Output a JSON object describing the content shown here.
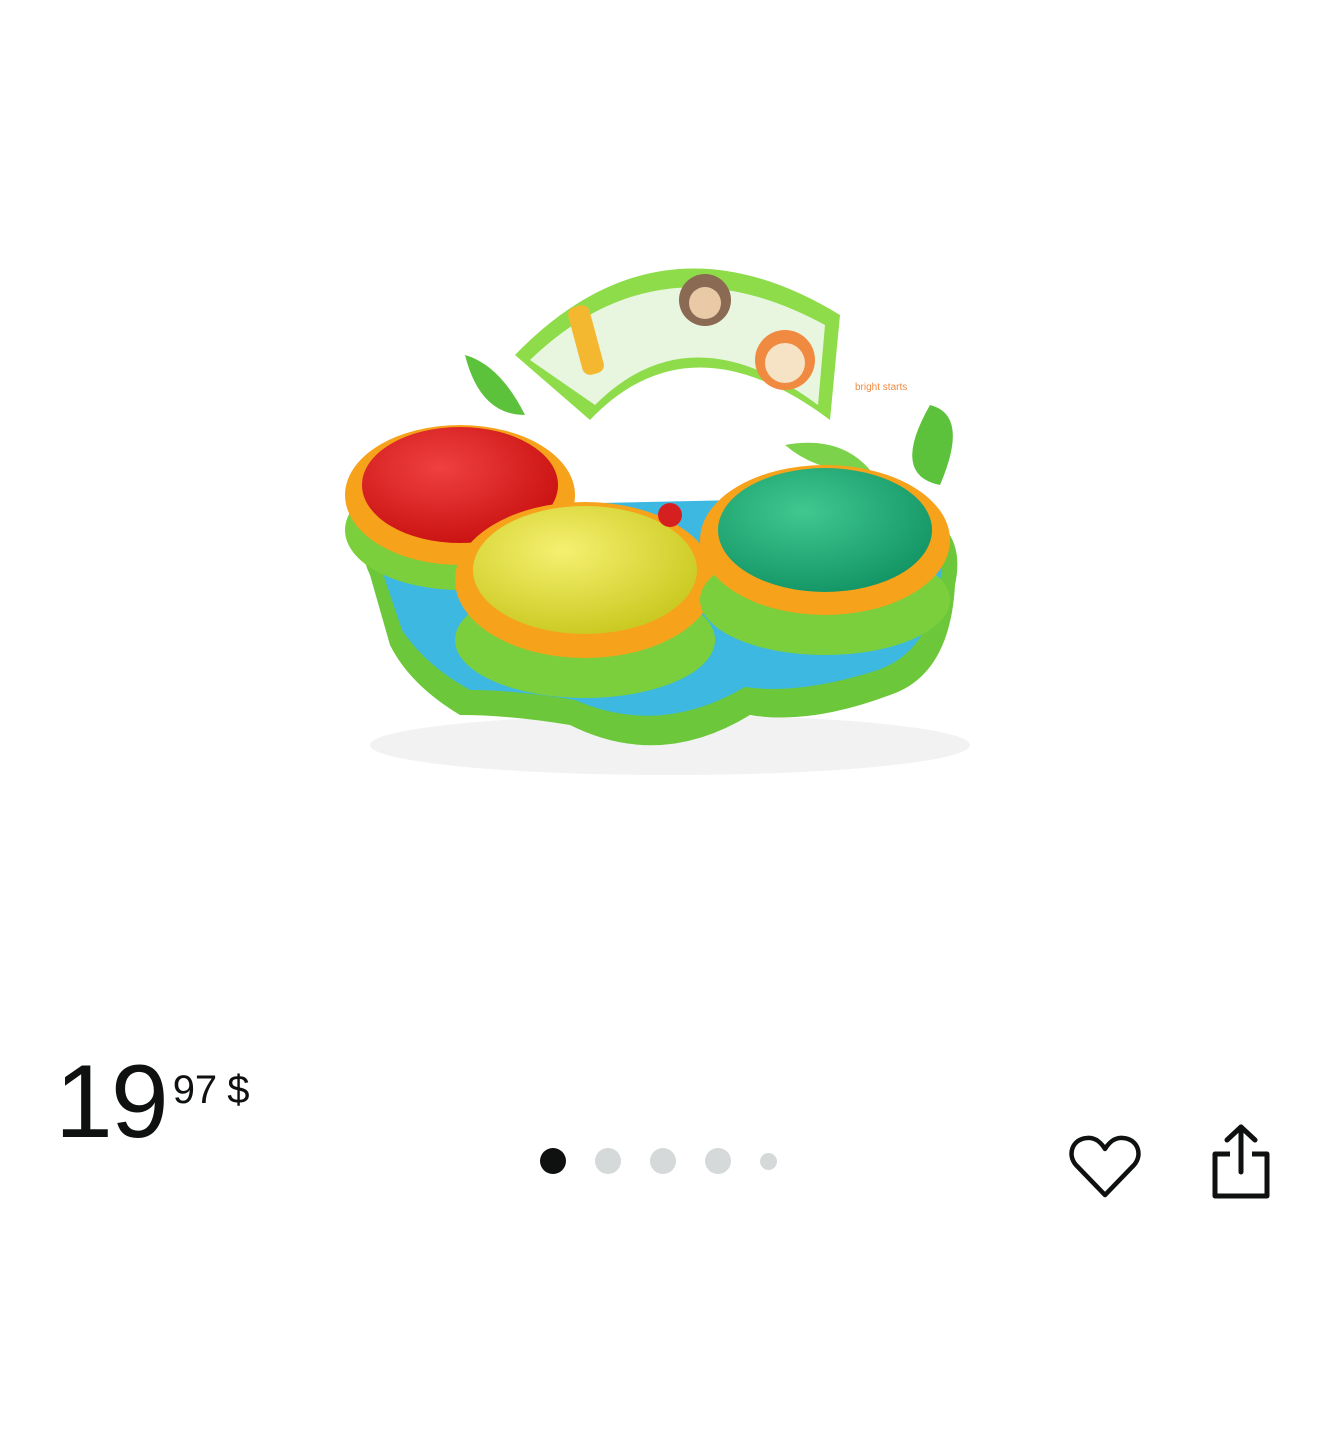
{
  "product": {
    "image_alt": "Safari bongo drums baby toy",
    "image_text": {
      "brand": "bright starts"
    }
  },
  "carousel": {
    "count": 5,
    "active_index": 0
  },
  "actions": {
    "wishlist_icon": "heart-outline-icon",
    "share_icon": "share-icon"
  },
  "price": {
    "whole": "19",
    "fraction": "97",
    "currency": "$"
  },
  "colors": {
    "text": "#0f1111",
    "dot_inactive": "#d5d9d9",
    "dot_active": "#0f1111"
  }
}
